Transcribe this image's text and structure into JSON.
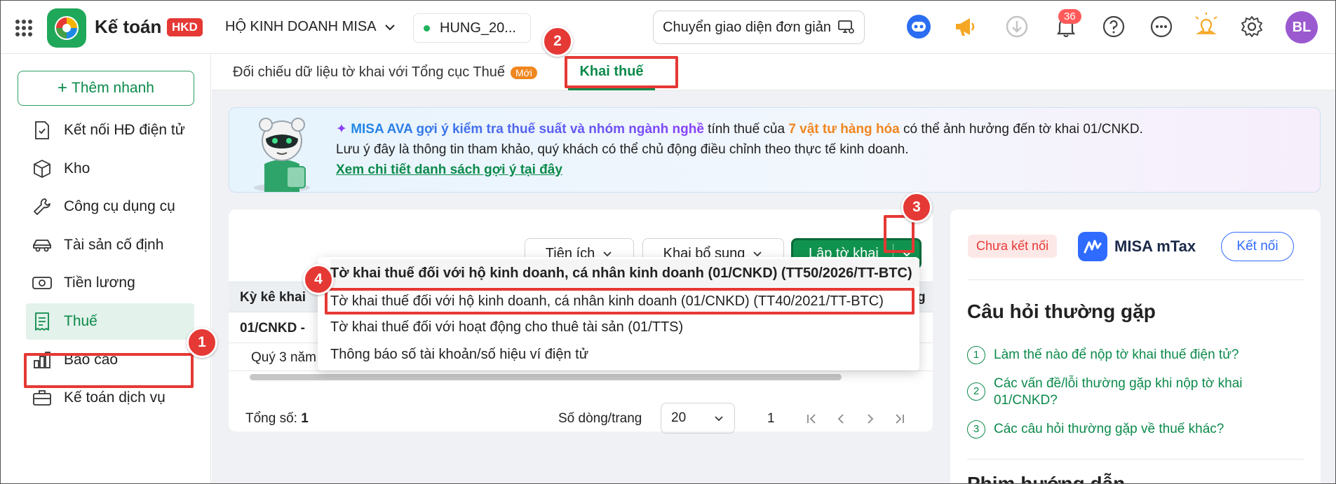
{
  "header": {
    "app_title": "Kế toán",
    "app_badge": "HKD",
    "company": "HỘ KINH DOANH MISA",
    "db_name": "HUNG_20...",
    "simple_ui_label": "Chuyển giao diện đơn giản",
    "notification_count": "36",
    "avatar_initials": "BL"
  },
  "sidebar": {
    "quick_add_label": "Thêm nhanh",
    "items": [
      {
        "label": "Kết nối HĐ điện tử",
        "icon": "invoice-link-icon"
      },
      {
        "label": "Kho",
        "icon": "box-icon"
      },
      {
        "label": "Công cụ dụng cụ",
        "icon": "wrench-icon"
      },
      {
        "label": "Tài sản cố định",
        "icon": "car-icon"
      },
      {
        "label": "Tiền lương",
        "icon": "money-icon"
      },
      {
        "label": "Thuế",
        "icon": "receipt-icon"
      },
      {
        "label": "Báo cáo",
        "icon": "bar-chart-icon"
      },
      {
        "label": "Kế toán dịch vụ",
        "icon": "briefcase-icon"
      }
    ]
  },
  "tabs": {
    "tab1_label": "Đối chiếu dữ liệu tờ khai với Tổng cục Thuế",
    "tab1_badge": "Mới",
    "tab2_label": "Khai thuế"
  },
  "banner": {
    "ava_prefix": "MISA AVA gợi ý kiểm tra thuế suất và nhóm ngành nghề",
    "text_mid": " tính thuế của ",
    "highlight_count": "7 vật tư hàng hóa",
    "text_end": " có thể ảnh hưởng đến tờ khai 01/CNKD.",
    "line2": "Lưu ý đây là thông tin tham khảo, quý khách có thể chủ động điều chỉnh theo thực tế kinh doanh.",
    "link": "Xem chi tiết danh sách gợi ý tại đây"
  },
  "toolbar": {
    "utilities_label": "Tiện ích",
    "supplement_label": "Khai bổ sung",
    "create_label": "Lập tờ khai"
  },
  "table": {
    "col_period": "Kỳ kê khai",
    "col_right_fragment": "g",
    "row_group": "01/CNKD -",
    "row_quarter": "Quý 3 năm"
  },
  "dropdown": {
    "items": [
      "Tờ khai thuế đối với hộ kinh doanh, cá nhân kinh doanh (01/CNKD) (TT50/2026/TT-BTC)",
      "Tờ khai thuế đối với hộ kinh doanh, cá nhân kinh doanh (01/CNKD) (TT40/2021/TT-BTC)",
      "Tờ khai thuế đối với hoạt động cho thuê tài sản (01/TTS)",
      "Thông báo số tài khoản/số hiệu ví điện tử"
    ]
  },
  "footer": {
    "total_label": "Tổng số:",
    "total_value": "1",
    "rows_per_page_label": "Số dòng/trang",
    "rows_per_page_value": "20",
    "page_number": "1"
  },
  "right_panel": {
    "status_badge": "Chưa kết nối",
    "brand": "MISA mTax",
    "connect_label": "Kết nối",
    "faq_title": "Câu hỏi thường gặp",
    "faqs": [
      {
        "num": "1",
        "text": "Làm thế nào để nộp tờ khai thuế điện tử?"
      },
      {
        "num": "2",
        "text": "Các vấn đề/lỗi thường gặp khi nộp tờ khai 01/CNKD?"
      },
      {
        "num": "3",
        "text": "Các câu hỏi thường gặp về thuế khác?"
      }
    ],
    "video_title": "Phim hướng dẫn"
  },
  "steps": [
    "1",
    "2",
    "3",
    "4"
  ],
  "colors": {
    "brand_green": "#0c8a4b",
    "accent_red": "#e53935",
    "badge_orange": "#f0861f",
    "ava_purple": "#8a3ffc"
  }
}
